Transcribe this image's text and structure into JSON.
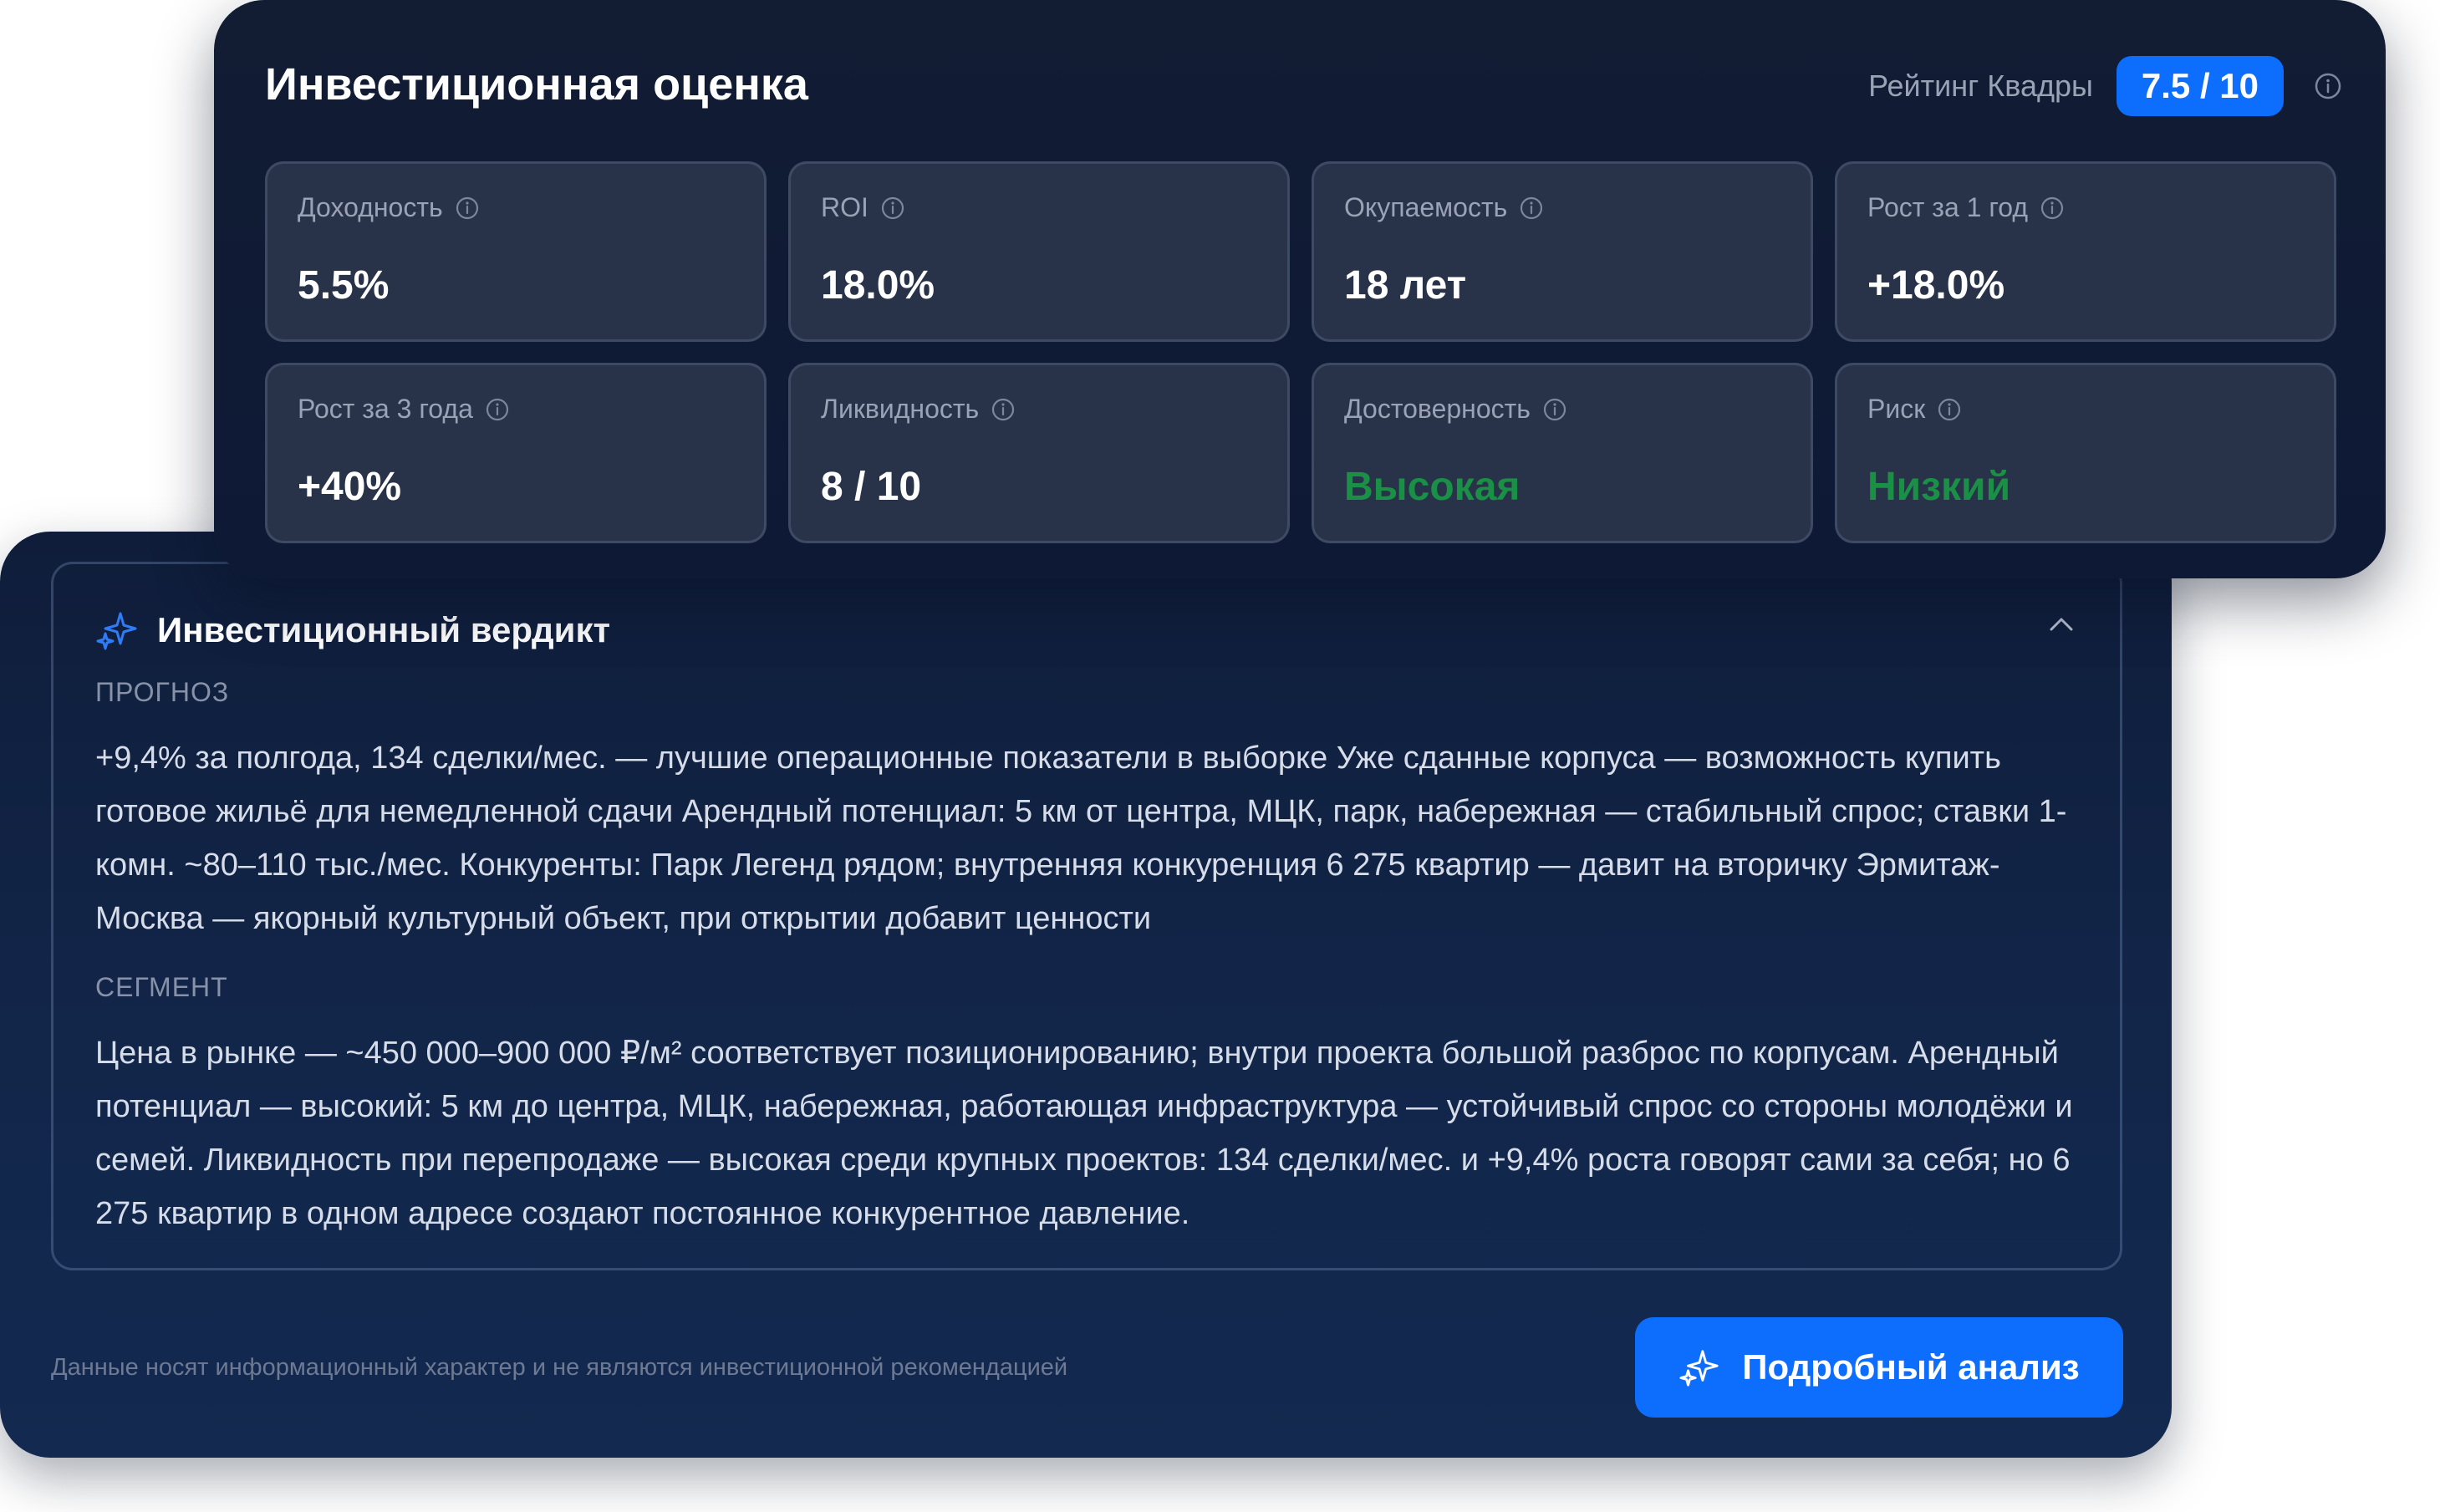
{
  "score_card": {
    "title": "Инвестиционная оценка",
    "rating_label": "Рейтинг Квадры",
    "rating_value": "7.5 / 10",
    "metrics": [
      {
        "label": "Доходность",
        "value": "5.5%"
      },
      {
        "label": "ROI",
        "value": "18.0%"
      },
      {
        "label": "Окупаемость",
        "value": "18 лет"
      },
      {
        "label": "Рост за 1 год",
        "value": "+18.0%"
      },
      {
        "label": "Рост за 3 года",
        "value": "+40%"
      },
      {
        "label": "Ликвидность",
        "value": "8 / 10"
      },
      {
        "label": "Достоверность",
        "value": "Высокая"
      },
      {
        "label": "Риск",
        "value": "Низкий"
      }
    ]
  },
  "verdict": {
    "title": "Инвестиционный вердикт",
    "forecast_label": "ПРОГНОЗ",
    "forecast_text": "+9,4% за полгода, 134 сделки/мес. — лучшие операционные показатели в выборке Уже сданные корпуса — возможность купить готовое жильё для немедленной сдачи Арендный потенциал: 5 км от центра, МЦК, парк, набережная — стабильный спрос; ставки 1-комн. ~80–110 тыс./мес. Конкуренты: Парк Легенд рядом; внутренняя конкуренция 6 275 квартир — давит на вторичку Эрмитаж-Москва — якорный культурный объект, при открытии добавит ценности",
    "segment_label": "СЕГМЕНТ",
    "segment_text": "Цена в рынке — ~450 000–900 000 ₽/м² соответствует позиционированию; внутри проекта большой разброс по корпусам. Арендный потенциал — высокий: 5 км до центра, МЦК, набережная, работающая инфраструктура — устойчивый спрос со стороны молодёжи и семей. Ликвидность при перепродаже — высокая среди крупных проектов: 134 сделки/мес. и +9,4% роста говорят сами за себя; но 6 275 квартир в одном адресе создают постоянное конкурентное давление.",
    "disclaimer": "Данные носят информационный характер и не являются инвестиционной рекомендацией",
    "detail_button": "Подробный анализ"
  },
  "colors": {
    "accent": "#0d6efd",
    "positive": "#1a8f46",
    "card_bg": "#121c33",
    "tile_bg": "#283349"
  },
  "icons": {
    "rating_info": "info-icon",
    "verdict": "sparkle-icon",
    "collapse": "chevron-up-icon",
    "button": "sparkle-icon"
  }
}
